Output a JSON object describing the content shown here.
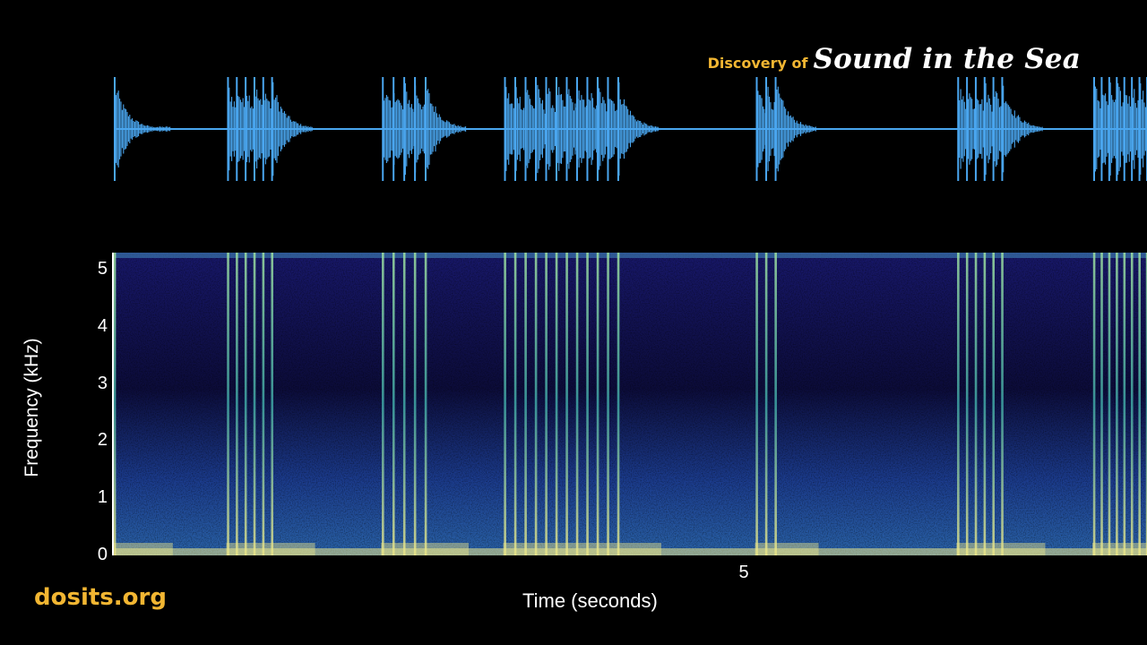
{
  "brand": {
    "prefix": "Discovery of",
    "title": "Sound in the Sea",
    "site": "dosits.org"
  },
  "colors": {
    "wave": "#4aa6ef",
    "accent": "#f2b632",
    "spectro_bg": "#0f1150",
    "spectro_mid": "#2a3a9a",
    "spectro_hi": "#e8e48a"
  },
  "chart_data": [
    {
      "type": "line",
      "name": "waveform",
      "title": "",
      "xlabel": "",
      "ylabel": "",
      "xlim": [
        0,
        8.2
      ],
      "grid": false,
      "click_trains": [
        {
          "start": 0.0,
          "end": 0.12,
          "clicks": 1
        },
        {
          "start": 0.9,
          "end": 1.25,
          "clicks": 6
        },
        {
          "start": 2.13,
          "end": 2.47,
          "clicks": 5
        },
        {
          "start": 3.1,
          "end": 4.0,
          "clicks": 12
        },
        {
          "start": 5.1,
          "end": 5.25,
          "clicks": 3
        },
        {
          "start": 6.7,
          "end": 7.05,
          "clicks": 6
        },
        {
          "start": 7.78,
          "end": 8.2,
          "clicks": 8
        }
      ]
    },
    {
      "type": "heatmap",
      "name": "spectrogram",
      "title": "",
      "xlabel": "Time (seconds)",
      "ylabel": "Frequency (kHz)",
      "xlim": [
        0,
        8.2
      ],
      "ylim": [
        0,
        5.3
      ],
      "x_ticks": [
        "5"
      ],
      "x_tick_values": [
        5
      ],
      "y_ticks": [
        "0",
        "1",
        "2",
        "3",
        "4",
        "5"
      ],
      "y_tick_values": [
        0,
        1,
        2,
        3,
        4,
        5
      ],
      "grid": false
    }
  ]
}
